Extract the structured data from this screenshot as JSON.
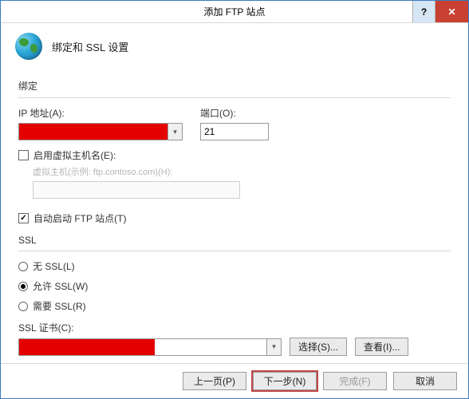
{
  "titlebar": {
    "title": "添加 FTP 站点"
  },
  "header": {
    "title": "绑定和 SSL 设置"
  },
  "binding": {
    "group_label": "绑定",
    "ip_label": "IP 地址(A):",
    "port_label": "端口(O):",
    "port_value": "21",
    "vhost_checkbox_label": "启用虚拟主机名(E):",
    "vhost_hint": "虚拟主机(示例: ftp.contoso.com)(H):"
  },
  "autostart": {
    "label": "自动启动 FTP 站点(T)"
  },
  "ssl": {
    "group_label": "SSL",
    "no_ssl": "无 SSL(L)",
    "allow_ssl": "允许 SSL(W)",
    "require_ssl": "需要 SSL(R)",
    "cert_label": "SSL 证书(C):",
    "select_btn": "选择(S)...",
    "view_btn": "查看(I)..."
  },
  "footer": {
    "prev": "上一页(P)",
    "next": "下一步(N)",
    "finish": "完成(F)",
    "cancel": "取消"
  }
}
